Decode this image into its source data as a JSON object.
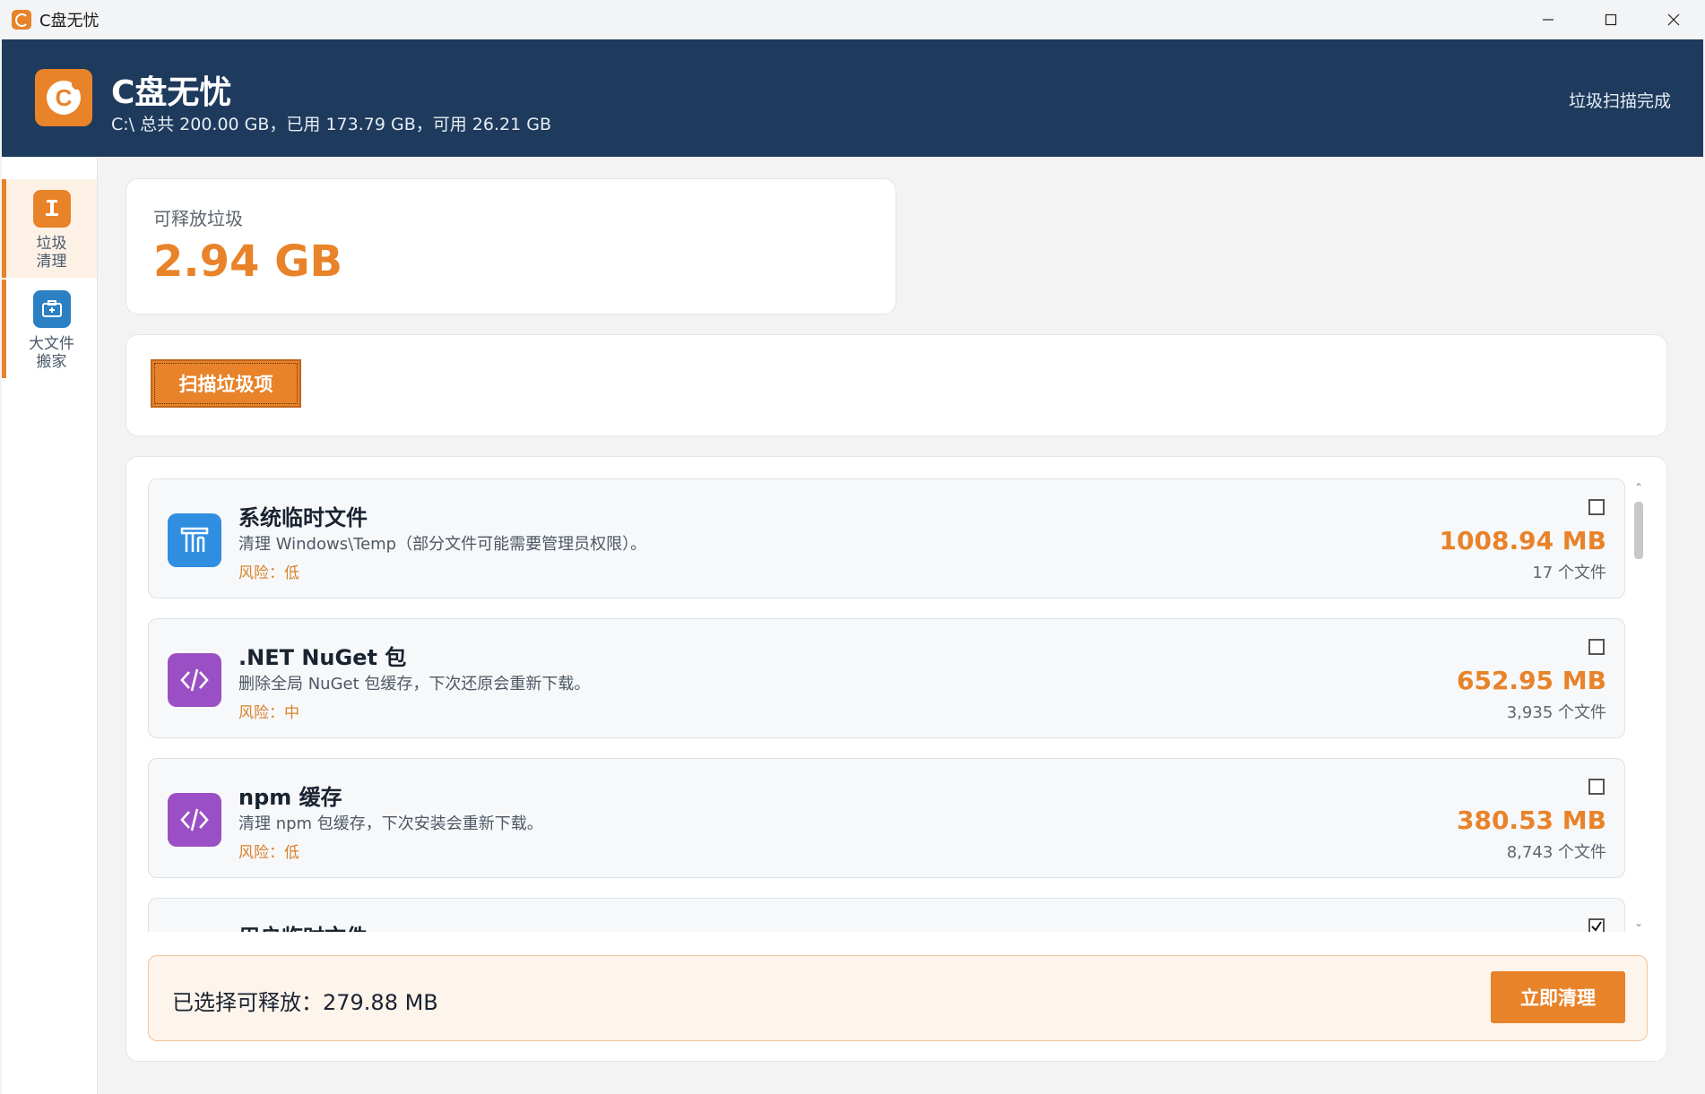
{
  "window": {
    "title": "C盘无忧"
  },
  "header": {
    "app_name": "C盘无忧",
    "logo_letter": "C",
    "disk_info": "C:\\ 总共 200.00 GB，已用 173.79 GB，可用 26.21 GB",
    "status": "垃圾扫描完成"
  },
  "sidebar": {
    "items": [
      {
        "label": "垃圾\n清理",
        "icon": "broom-icon",
        "active": true,
        "color": "#e8832a"
      },
      {
        "label": "大文件\n搬家",
        "icon": "move-box-icon",
        "active": false,
        "color": "#2b7fc3"
      }
    ]
  },
  "summary": {
    "label": "可释放垃圾",
    "value": "2.94 GB"
  },
  "actions": {
    "scan_label": "扫描垃圾项"
  },
  "items": [
    {
      "title": "系统临时文件",
      "description": "清理 Windows\\Temp（部分文件可能需要管理员权限）。",
      "risk": "风险：低",
      "size": "1008.94 MB",
      "count": "17 个文件",
      "checked": false,
      "icon": "windows-temp-icon",
      "icon_color": "#2f8ee0"
    },
    {
      "title": ".NET NuGet 包",
      "description": "删除全局 NuGet 包缓存，下次还原会重新下载。",
      "risk": "风险：中",
      "size": "652.95 MB",
      "count": "3,935 个文件",
      "checked": false,
      "icon": "code-icon",
      "icon_color": "#9b4fc4"
    },
    {
      "title": "npm 缓存",
      "description": "清理 npm 包缓存，下次安装会重新下载。",
      "risk": "风险：低",
      "size": "380.53 MB",
      "count": "8,743 个文件",
      "checked": false,
      "icon": "code-icon",
      "icon_color": "#9b4fc4"
    },
    {
      "title": "用户临时文件",
      "description": "",
      "risk": "",
      "size": "",
      "count": "",
      "checked": true,
      "icon": "user-temp-icon",
      "icon_color": "#2f8ee0"
    }
  ],
  "footer": {
    "selected_text": "已选择可释放：279.88 MB",
    "clean_label": "立即清理"
  },
  "colors": {
    "accent": "#e8832a",
    "header_bg": "#1e3a5c"
  }
}
